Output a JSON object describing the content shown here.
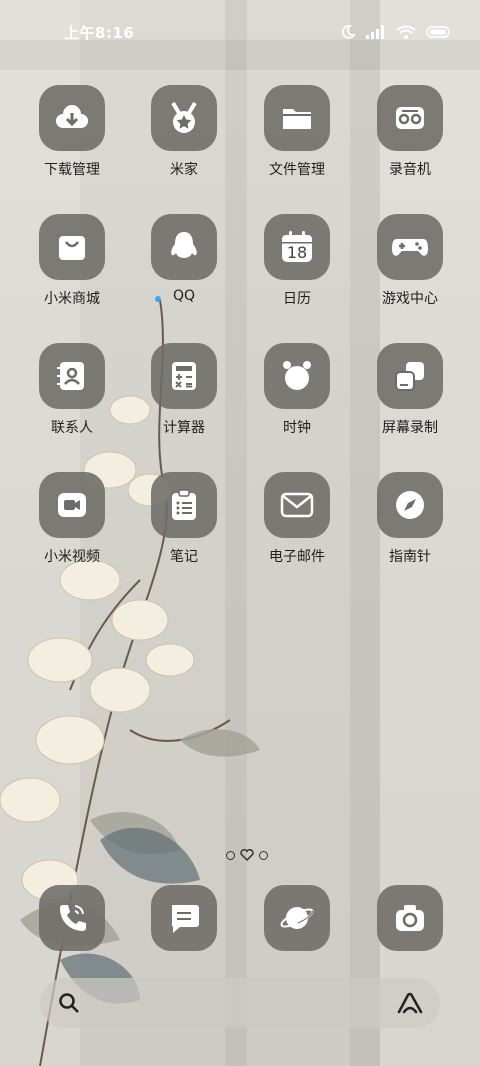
{
  "status_bar": {
    "time": "上午8:16",
    "icons": [
      "moon-icon",
      "signal-icon",
      "wifi-icon",
      "battery-icon"
    ]
  },
  "apps": [
    {
      "label": "下载管理",
      "icon": "download-cloud-icon"
    },
    {
      "label": "米家",
      "icon": "medal-icon"
    },
    {
      "label": "文件管理",
      "icon": "folder-icon"
    },
    {
      "label": "录音机",
      "icon": "recorder-icon"
    },
    {
      "label": "小米商城",
      "icon": "shopping-bag-icon"
    },
    {
      "label": "QQ",
      "icon": "penguin-icon"
    },
    {
      "label": "日历",
      "icon": "calendar-icon",
      "day": "18"
    },
    {
      "label": "游戏中心",
      "icon": "gamepad-icon"
    },
    {
      "label": "联系人",
      "icon": "contacts-icon"
    },
    {
      "label": "计算器",
      "icon": "calculator-icon"
    },
    {
      "label": "时钟",
      "icon": "alarm-clock-icon"
    },
    {
      "label": "屏幕录制",
      "icon": "screen-record-icon"
    },
    {
      "label": "小米视频",
      "icon": "video-icon"
    },
    {
      "label": "笔记",
      "icon": "notes-icon"
    },
    {
      "label": "电子邮件",
      "icon": "mail-icon"
    },
    {
      "label": "指南针",
      "icon": "compass-icon"
    }
  ],
  "dock": [
    "phone-icon",
    "message-icon",
    "browser-planet-icon",
    "camera-icon"
  ],
  "search_bar": {
    "left_icon": "search-icon",
    "right_icon": "assistant-icon"
  },
  "colors": {
    "tile": "#6e6c68",
    "icon": "#ffffff",
    "label": "#1f1f1f",
    "qq_dot": "#3fa6f5"
  }
}
